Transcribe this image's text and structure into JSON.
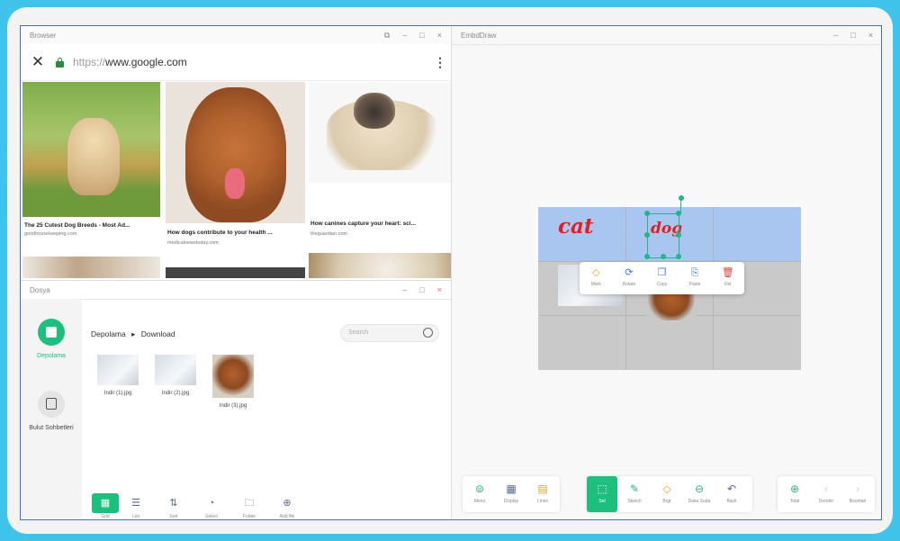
{
  "browser": {
    "title": "Browser",
    "window_buttons": [
      "⧉",
      "–",
      "□",
      "×"
    ],
    "url_scheme": "https://",
    "url_host": "www.google.com",
    "results": [
      {
        "caption": "The 25 Cutest Dog Breeds - Most Ad...",
        "source": "goodhousekeeping.com"
      },
      {
        "caption": "How dogs contribute to your health ...",
        "source": "medicalnewstoday.com"
      },
      {
        "caption": "How canines capture your heart: sci...",
        "source": "theguardian.com"
      }
    ]
  },
  "files": {
    "title": "Dosya",
    "window_buttons": [
      "–",
      "□",
      "×"
    ],
    "sidebar": [
      {
        "label": "Depolama",
        "icon": "storage-icon",
        "active": true
      },
      {
        "label": "Bulut Sohbetleri",
        "icon": "cloud-drive-icon",
        "active": false
      }
    ],
    "breadcrumb": {
      "root": "Depolama",
      "separator": "▸",
      "folder": "Download"
    },
    "search_placeholder": "Search",
    "items": [
      {
        "name": "Indir (1).jpg"
      },
      {
        "name": "Indir (2).jpg"
      },
      {
        "name": "Indir (3).jpg"
      }
    ],
    "toolbar": [
      {
        "label": "Grid",
        "glyph": "▦"
      },
      {
        "label": "List",
        "glyph": "☰"
      },
      {
        "label": "Sort",
        "glyph": "⇅"
      },
      {
        "label": "Select",
        "glyph": "◔"
      },
      {
        "label": "Folder",
        "glyph": "🗀"
      },
      {
        "label": "Add file",
        "glyph": "⊕"
      }
    ]
  },
  "note": {
    "title": "EmbdDraw",
    "window_buttons": [
      "–",
      "□",
      "×"
    ],
    "canvas_text": [
      "cat",
      "dog"
    ],
    "context_menu": [
      {
        "label": "Mark",
        "glyph": "◇",
        "color": "#e6a11f"
      },
      {
        "label": "Rotate",
        "glyph": "⟳",
        "color": "#3a7bd5"
      },
      {
        "label": "Copy",
        "glyph": "❐",
        "color": "#3a7bd5"
      },
      {
        "label": "Paste",
        "glyph": "⎘",
        "color": "#3a7bd5"
      },
      {
        "label": "Del",
        "glyph": "🗑",
        "color": "#e04040"
      }
    ],
    "toolbar_left": [
      {
        "label": "Menu",
        "glyph": "⊜"
      },
      {
        "label": "Display",
        "glyph": "▦"
      },
      {
        "label": "Lines",
        "glyph": "▤"
      }
    ],
    "toolbar_mid": [
      {
        "label": "Sel",
        "glyph": "⬚"
      },
      {
        "label": "Sketch",
        "glyph": "✎"
      },
      {
        "label": "Brgt",
        "glyph": "◇"
      },
      {
        "label": "Deka Suda",
        "glyph": "⊖"
      },
      {
        "label": "Back",
        "glyph": "↶"
      }
    ],
    "toolbar_right": [
      {
        "label": "Total",
        "glyph": "⊕"
      },
      {
        "label": "Donder",
        "glyph": "‹"
      },
      {
        "label": "Bountah",
        "glyph": "›"
      }
    ]
  },
  "colors": {
    "accent": "#1dbf7f",
    "frame": "#3fc3ea",
    "canvas_highlight": "#a8c6f0",
    "handwriting": "#e02020"
  }
}
